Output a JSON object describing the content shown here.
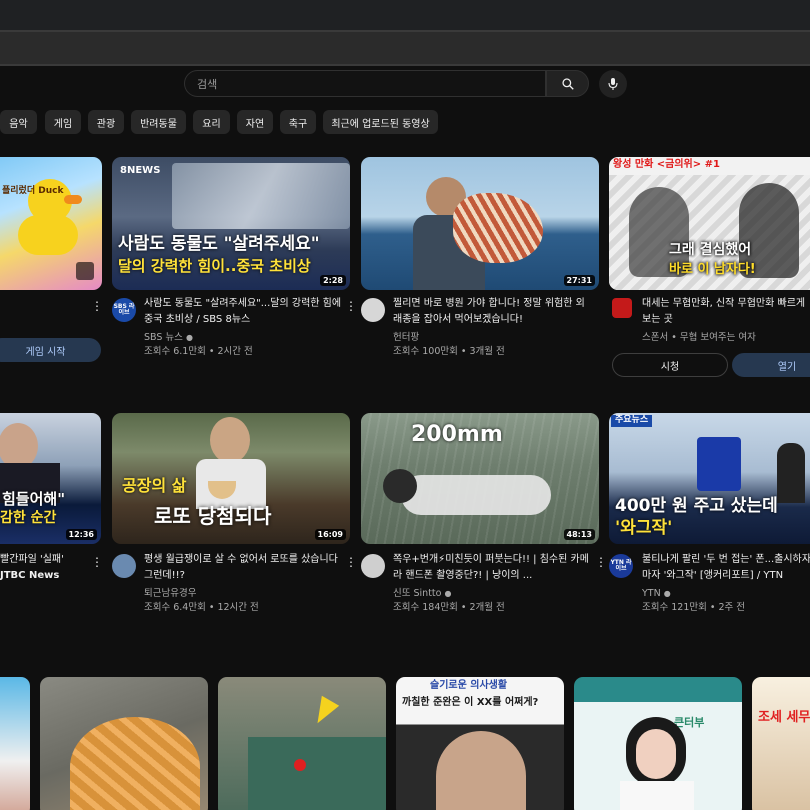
{
  "search": {
    "placeholder": "검색"
  },
  "chips": [
    "음악",
    "게임",
    "관광",
    "반려동물",
    "요리",
    "자연",
    "축구",
    "최근에 업로드된 동영상"
  ],
  "row1": [
    {
      "overlay": "플리렀더 Duck",
      "action_label": "게임 시작"
    },
    {
      "overlay_logo": "8NEWS",
      "overlay_line1": "사람도 동물도 \"살려주세요\"",
      "overlay_line2": "달의 강력한 힘이..중국 초비상",
      "duration": "2:28",
      "avatar_text": "SBS 라이브",
      "title": "사람도 동물도 \"살려주세요\"...달의 강력한 힘에 중국 초비상 / SBS 8뉴스",
      "channel": "SBS 뉴스",
      "stats": "조회수 6.1만회 • 2시간 전"
    },
    {
      "duration": "27:31",
      "title": "찔리면 바로 병원 가야 합니다! 정말 위험한 외래종을 잡아서 먹어보겠습니다!",
      "channel": "헌터팡",
      "stats": "조회수 100만회 • 3개월 전"
    },
    {
      "overlay_top": "왕성 만화 <금의위> #1",
      "overlay_line1": "그래 결심했어",
      "overlay_line2": "바로 이 남자다!",
      "title": "대세는 무협만화, 신작 무협만화 빠르게 보는 곳",
      "channel": "스폰서 • 무협 보여주는 여자",
      "btn_watch": "시청",
      "btn_open": "열기"
    }
  ],
  "row2": [
    {
      "overlay_line1": "힘들어해\"",
      "overlay_line2": "감한 순간",
      "duration": "12:36",
      "title_tail": "빨간파일 '실패'",
      "channel_tail": "JTBC News"
    },
    {
      "overlay_line1": "공장의 삶",
      "overlay_line2": "로또 당첨되다",
      "duration": "16:09",
      "title": "평생 월급쟁이로 살 수 없어서 로또를 샀습니다 그런데!!?",
      "channel": "퇴근남유경우",
      "stats": "조회수 6.4만회 • 12시간 전"
    },
    {
      "overlay_line1": "200mm",
      "duration": "48:13",
      "title": "쪽우+번개⚡미친듯이 퍼붓는다!! | 침수된 카메라 핸드폰 촬영중단?! | 냥이의 ...",
      "channel": "신또 Sintto",
      "stats": "조회수 184만회 • 2개월 전"
    },
    {
      "overlay_tag": "주요뉴스",
      "overlay_line1": "400만 원 주고 샀는데",
      "overlay_line2": "'와그작'",
      "avatar_text": "YTN 라이브",
      "title": "불티나게 팔린 '두 번 접는' 폰...출시하자마자 '와그작' [앵커리포트] / YTN",
      "channel": "YTN",
      "stats": "조회수 121만회 • 2주 전"
    }
  ],
  "row3": [
    {
      "overlay": ""
    },
    {
      "overlay": ""
    },
    {
      "overlay": ""
    },
    {
      "overlay_top": "슬기로운 의사생활",
      "overlay_line1": "까칠한 준완은 이 XX를 어쩌게?"
    },
    {
      "overlay_line1": "큰터부"
    },
    {
      "overlay_line1": "조세 세무"
    }
  ],
  "icons": {
    "search": "search-icon",
    "mic": "mic-icon",
    "verified": "verified-icon",
    "more": "more-vert-icon"
  }
}
